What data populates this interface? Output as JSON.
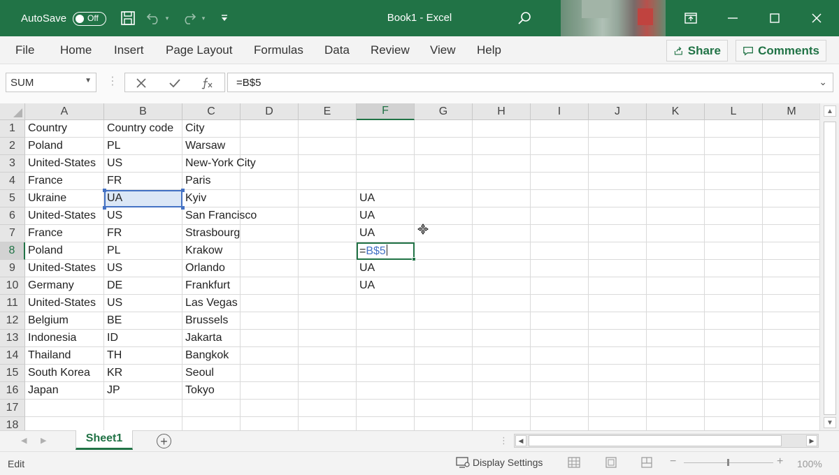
{
  "app": {
    "autosave_label": "AutoSave",
    "autosave_state": "Off",
    "doc_title": "Book1  -  Excel"
  },
  "ribbon": {
    "tabs": [
      "File",
      "Home",
      "Insert",
      "Page Layout",
      "Formulas",
      "Data",
      "Review",
      "View",
      "Help"
    ],
    "share_label": "Share",
    "comments_label": "Comments"
  },
  "formula_bar": {
    "name_box": "SUM",
    "formula": "=B$5"
  },
  "grid": {
    "columns": [
      "A",
      "B",
      "C",
      "D",
      "E",
      "F",
      "G",
      "H",
      "I",
      "J",
      "K",
      "L",
      "M"
    ],
    "rows": [
      "1",
      "2",
      "3",
      "4",
      "5",
      "6",
      "7",
      "8",
      "9",
      "10",
      "11",
      "12",
      "13",
      "14",
      "15",
      "16",
      "17",
      "18"
    ],
    "cells": {
      "A1": "Country",
      "B1": "Country code",
      "C1": "City",
      "A2": "Poland",
      "B2": "PL",
      "C2": "Warsaw",
      "A3": "United-States",
      "B3": "US",
      "C3": "New-York City",
      "A4": "France",
      "B4": "FR",
      "C4": "Paris",
      "A5": "Ukraine",
      "B5": "UA",
      "C5": "Kyiv",
      "F5": "UA",
      "A6": "United-States",
      "B6": "US",
      "C6": "San Francisco",
      "F6": "UA",
      "A7": "France",
      "B7": "FR",
      "C7": "Strasbourg",
      "F7": "UA",
      "A8": "Poland",
      "B8": "PL",
      "C8": "Krakow",
      "A9": "United-States",
      "B9": "US",
      "C9": "Orlando",
      "F9": "UA",
      "A10": "Germany",
      "B10": "DE",
      "C10": "Frankfurt",
      "F10": "UA",
      "A11": "United-States",
      "B11": "US",
      "C11": "Las Vegas",
      "A12": "Belgium",
      "B12": "BE",
      "C12": "Brussels",
      "A13": "Indonesia",
      "B13": "ID",
      "C13": "Jakarta",
      "A14": "Thailand",
      "B14": "TH",
      "C14": "Bangkok",
      "A15": "South Korea",
      "B15": "KR",
      "C15": "Seoul",
      "A16": "Japan",
      "B16": "JP",
      "C16": "Tokyo"
    },
    "active_cell": "F8",
    "referenced_cell": "B5",
    "edit_prefix": "=",
    "edit_ref": "B$5"
  },
  "sheets": {
    "tabs": [
      "Sheet1"
    ],
    "active": "Sheet1"
  },
  "status": {
    "mode": "Edit",
    "display_settings": "Display Settings",
    "zoom": "100%"
  },
  "colors": {
    "brand": "#217346",
    "reference": "#4472c4"
  }
}
